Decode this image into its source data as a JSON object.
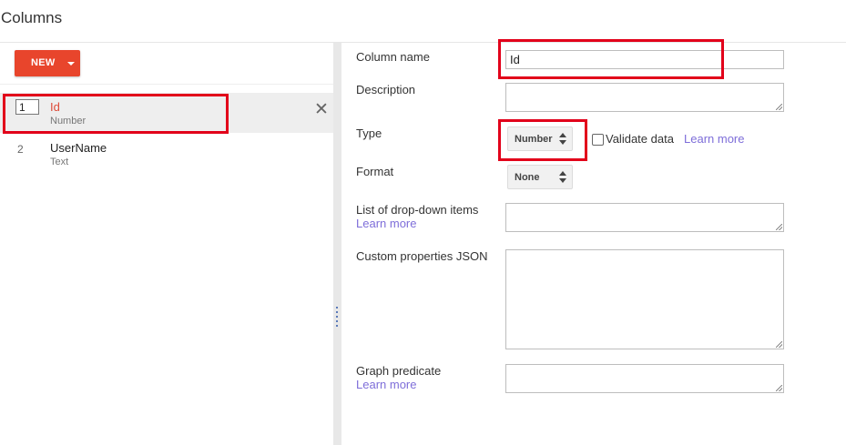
{
  "page": {
    "title": "Columns"
  },
  "left": {
    "new_button": "NEW",
    "columns": [
      {
        "order": "1",
        "name": "Id",
        "type": "Number"
      },
      {
        "order": "2",
        "name": "UserName",
        "type": "Text"
      }
    ]
  },
  "form": {
    "column_name": {
      "label": "Column name",
      "value": "Id"
    },
    "description": {
      "label": "Description",
      "value": ""
    },
    "type": {
      "label": "Type",
      "value": "Number",
      "validate_label": "Validate data",
      "learn_more": "Learn more"
    },
    "format": {
      "label": "Format",
      "value": "None"
    },
    "dropdown_items": {
      "label": "List of drop-down items",
      "learn_more": "Learn more",
      "value": ""
    },
    "custom_json": {
      "label": "Custom properties JSON",
      "value": ""
    },
    "graph_predicate": {
      "label": "Graph predicate",
      "learn_more": "Learn more",
      "value": ""
    }
  },
  "colors": {
    "accent": "#e8452c",
    "link": "#7e6ed9",
    "annotation": "#e2001a",
    "selected_name": "#dd4b39"
  }
}
